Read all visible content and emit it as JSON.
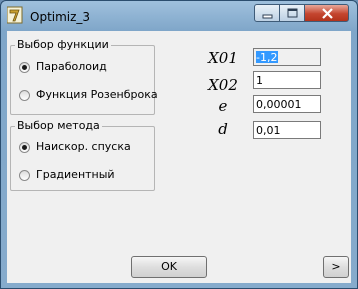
{
  "window": {
    "title": "Optimiz_3"
  },
  "function_group": {
    "title": "Выбор функции",
    "options": [
      {
        "label": "Параболоид",
        "selected": true
      },
      {
        "label": "Функция Розенброка",
        "selected": false
      }
    ]
  },
  "method_group": {
    "title": "Выбор метода",
    "options": [
      {
        "label": "Наискор. спуска",
        "selected": true
      },
      {
        "label": "Градиентный",
        "selected": false
      }
    ]
  },
  "params": [
    {
      "label": "X01",
      "value": "-1,2"
    },
    {
      "label": "X02",
      "value": "1"
    },
    {
      "label": "e",
      "value": "0,00001"
    },
    {
      "label": "d",
      "value": "0,01"
    }
  ],
  "buttons": {
    "ok": "OK",
    "next": ">"
  },
  "colors": {
    "title_bar": "#9fc0dd",
    "client_bg": "#f0f0f0",
    "close_button": "#c4452f",
    "selection": "#3399ff"
  }
}
